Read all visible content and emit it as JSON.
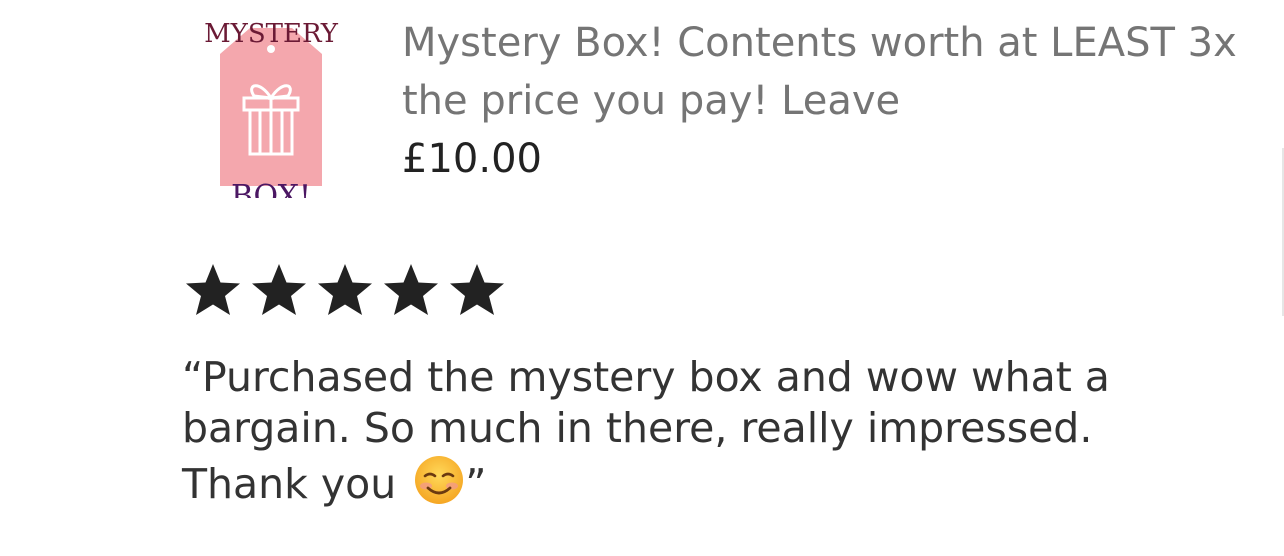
{
  "product": {
    "image": {
      "alt": "Mystery box gift tag",
      "text_top": "MYSTERY",
      "text_bottom": "BOX!",
      "tag_color": "#f4a7ad",
      "icon": "gift-icon"
    },
    "title": "Mystery Box! Contents worth at LEAST 3x the price you pay! Leave",
    "price": "£10.00"
  },
  "review": {
    "rating": 5,
    "rating_max": 5,
    "star_icon": "star-icon",
    "text": "“Purchased the mystery box and wow what a bargain. So much in there, really impressed. Thank you",
    "emoji": "smiling-face-icon",
    "closing_quote": "”"
  },
  "colors": {
    "title": "#757575",
    "price": "#222222",
    "review_text": "#333333",
    "star": "#222222"
  }
}
